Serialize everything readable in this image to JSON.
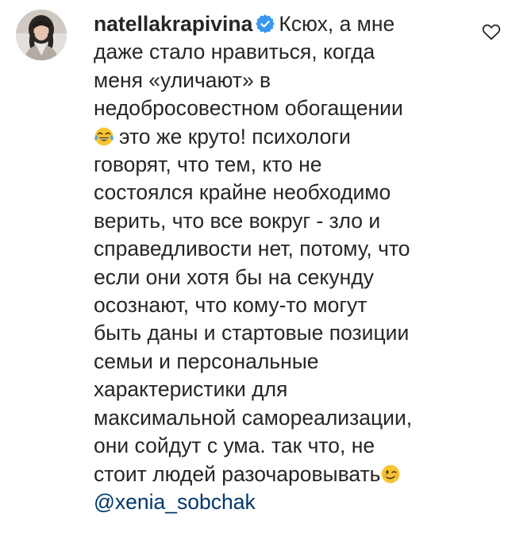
{
  "comment": {
    "username": "natellakrapivina",
    "verified": true,
    "lines": [
      "Ксюх, а мне",
      "даже стало нравиться, когда",
      "меня «уличают» в",
      "недобросовестном обогащении",
      "это же круто! психологи",
      "говорят, что тем, кто не",
      "состоялся крайне необходимо",
      "верить, что все вокруг - зло и",
      "справедливости нет, потому, что",
      "если они хотя бы на секунду",
      "осознают, что кому-то могут",
      "быть даны и стартовые позиции",
      "семьи и персональные",
      "характеристики для",
      "максимальной самореализации,",
      "они сойдут с ума. так что, не",
      "стоит людей разочаровывать"
    ],
    "emoji_1": "tears-of-joy-emoji",
    "emoji_2": "winking-face-emoji",
    "mention": "@xenia_sobchak"
  },
  "icons": {
    "verified": "verified-badge-icon",
    "like": "heart-outline-icon"
  },
  "colors": {
    "text": "#262626",
    "mention": "#00376b",
    "verified": "#3897f0",
    "icon_stroke": "#262626"
  }
}
